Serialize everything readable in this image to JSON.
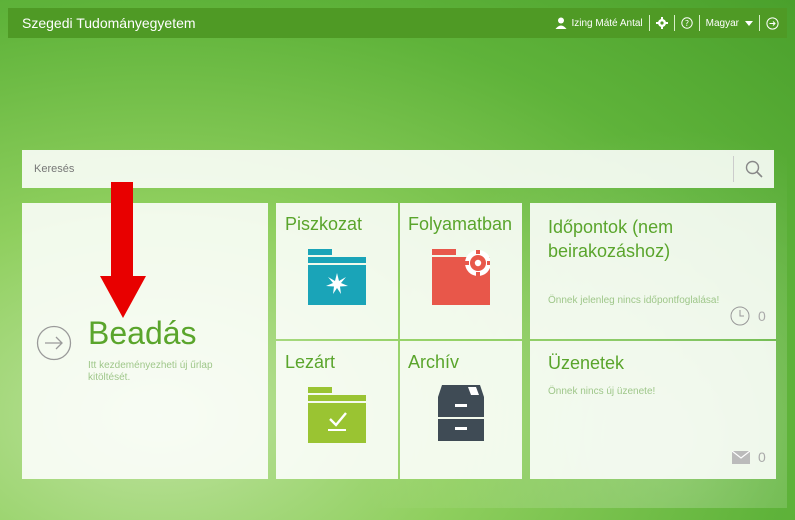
{
  "header": {
    "brand": "Szegedi Tudományegyetem",
    "user_name": "Izing Máté Antal",
    "language": "Magyar"
  },
  "search": {
    "placeholder": "Keresés"
  },
  "tiles": {
    "beadas": {
      "title": "Beadás",
      "description": "Itt kezdeményezheti új űrlap kitöltését."
    },
    "piszkozat": {
      "title": "Piszkozat"
    },
    "folyamatban": {
      "title": "Folyamatban"
    },
    "idopontok": {
      "title": "Időpontok (nem beirakozáshoz)",
      "text": "Önnek jelenleg nincs időpontfoglalása!",
      "count": "0"
    },
    "lezart": {
      "title": "Lezárt"
    },
    "archiv": {
      "title": "Archív"
    },
    "uzenetek": {
      "title": "Üzenetek",
      "text": "Önnek nincs új üzenete!",
      "count": "0"
    }
  },
  "colors": {
    "accent": "#5aa52c",
    "topbar": "#4f9a25",
    "folder_teal": "#1aa4b8",
    "folder_red": "#e8574a",
    "folder_lime": "#9ac432",
    "cabinet": "#3f4b55",
    "arrow": "#e80000"
  },
  "icons": [
    "user-icon",
    "gear-icon",
    "help-icon",
    "chevron-down-icon",
    "logout-icon",
    "search-icon",
    "arrow-right-circle-icon",
    "clock-icon",
    "mail-icon"
  ]
}
